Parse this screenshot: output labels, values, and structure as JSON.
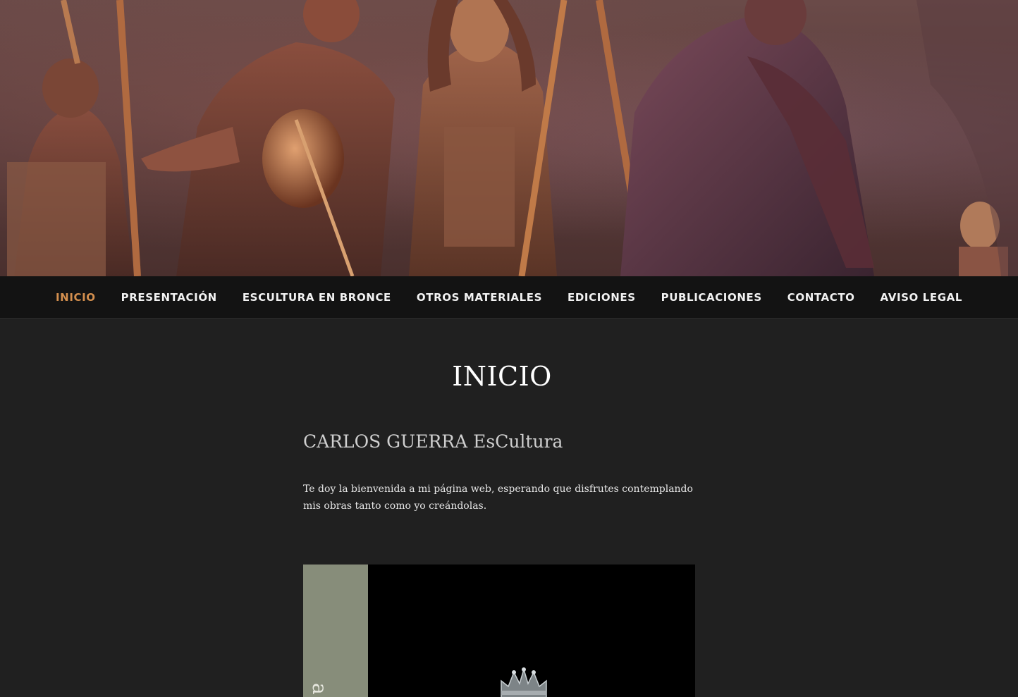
{
  "colors": {
    "page_background": "#202020",
    "nav_background": "#131313",
    "nav_active": "#d48f4e",
    "nav_text": "#f2f2f2",
    "band": "#878d7a"
  },
  "hero": {
    "alt": "bronze relief sculpture with robed figures"
  },
  "nav": {
    "items": [
      {
        "label": "INICIO",
        "active": true
      },
      {
        "label": "PRESENTACIÓN",
        "active": false
      },
      {
        "label": "ESCULTURA EN BRONCE",
        "active": false
      },
      {
        "label": "OTROS MATERIALES",
        "active": false
      },
      {
        "label": "EDICIONES",
        "active": false
      },
      {
        "label": "PUBLICACIONES",
        "active": false
      },
      {
        "label": "CONTACTO",
        "active": false
      },
      {
        "label": "AVISO LEGAL",
        "active": false
      }
    ]
  },
  "page": {
    "title": "INICIO",
    "subtitle": "CARLOS GUERRA EsCultura",
    "intro": "Te doy la bienvenida a mi página web, esperando que disfrutes contemplando mis obras tanto como yo creándolas."
  },
  "feature": {
    "band_text": "a"
  }
}
